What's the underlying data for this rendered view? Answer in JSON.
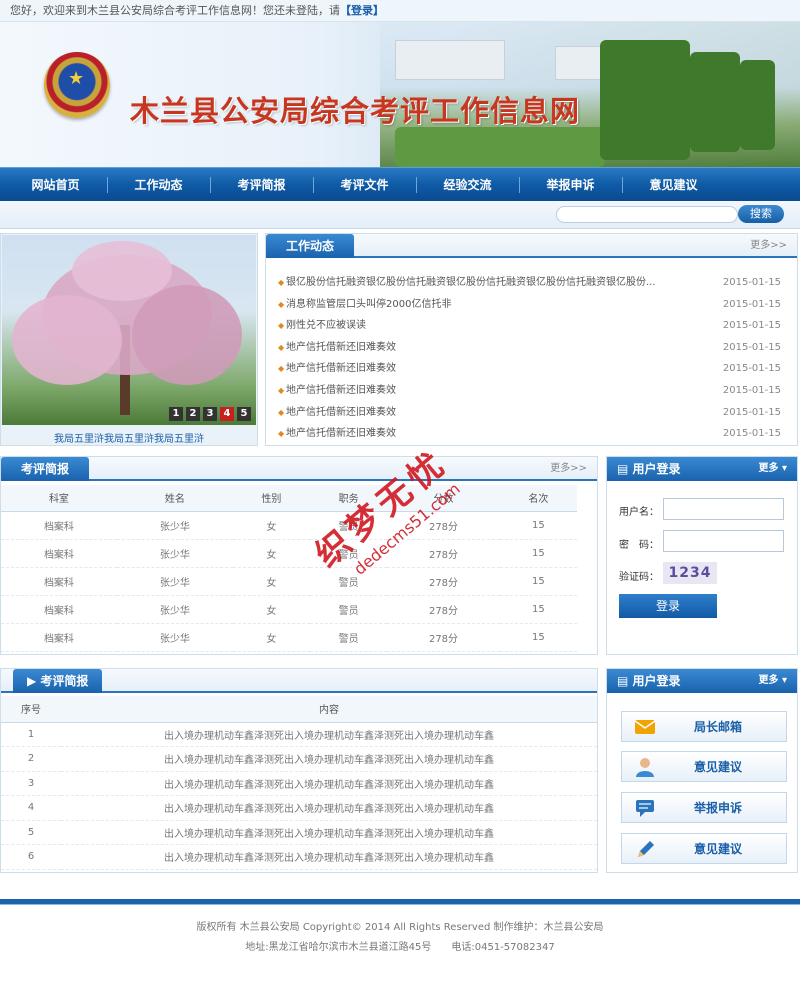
{
  "topbar": {
    "greeting": "您好，欢迎来到木兰县公安局综合考评工作信息网！您还未登陆，请",
    "login_link": "【登录】"
  },
  "header": {
    "site_title": "木兰县公安局综合考评工作信息网"
  },
  "nav": {
    "items": [
      "网站首页",
      "工作动态",
      "考评简报",
      "考评文件",
      "经验交流",
      "举报申诉",
      "意见建议"
    ]
  },
  "search": {
    "placeholder": "",
    "button": "搜索"
  },
  "slideshow": {
    "pages": [
      "1",
      "2",
      "3",
      "4",
      "5"
    ],
    "active_page": "4",
    "caption": "我局五里浒我局五里浒我局五里浒"
  },
  "work_news": {
    "title": "工作动态",
    "more": "更多>>",
    "items": [
      {
        "title": "银亿股份信托融资银亿股份信托融资银亿股份信托融资银亿股份信托融资银亿股份...",
        "date": "2015-01-15"
      },
      {
        "title": "消息称监管层口头叫停2000亿信托非",
        "date": "2015-01-15"
      },
      {
        "title": "刚性兑不应被误读",
        "date": "2015-01-15"
      },
      {
        "title": "地产信托借新还旧难奏效",
        "date": "2015-01-15"
      },
      {
        "title": "地产信托借新还旧难奏效",
        "date": "2015-01-15"
      },
      {
        "title": "地产信托借新还旧难奏效",
        "date": "2015-01-15"
      },
      {
        "title": "地产信托借新还旧难奏效",
        "date": "2015-01-15"
      },
      {
        "title": "地产信托借新还旧难奏效",
        "date": "2015-01-15"
      }
    ]
  },
  "ranking": {
    "title": "考评简报",
    "more": "更多>>",
    "columns": [
      "科室",
      "姓名",
      "性别",
      "职务",
      "分数",
      "名次"
    ],
    "rows": [
      [
        "档案科",
        "张少华",
        "女",
        "警员",
        "278分",
        "15"
      ],
      [
        "档案科",
        "张少华",
        "女",
        "警员",
        "278分",
        "15"
      ],
      [
        "档案科",
        "张少华",
        "女",
        "警员",
        "278分",
        "15"
      ],
      [
        "档案科",
        "张少华",
        "女",
        "警员",
        "278分",
        "15"
      ],
      [
        "档案科",
        "张少华",
        "女",
        "警员",
        "278分",
        "15"
      ]
    ]
  },
  "login": {
    "title": "用户登录",
    "more": "更多",
    "username_label": "用户名：",
    "password_label": "密　码：",
    "captcha_label": "验证码：",
    "captcha_value": "1234",
    "submit": "登录"
  },
  "briefing": {
    "title": "考评简报",
    "columns": [
      "序号",
      "内容"
    ],
    "rows": [
      [
        "1",
        "出入境办理机动车鑫泽测死出入境办理机动车鑫泽测死出入境办理机动车鑫"
      ],
      [
        "2",
        "出入境办理机动车鑫泽测死出入境办理机动车鑫泽测死出入境办理机动车鑫"
      ],
      [
        "3",
        "出入境办理机动车鑫泽测死出入境办理机动车鑫泽测死出入境办理机动车鑫"
      ],
      [
        "4",
        "出入境办理机动车鑫泽测死出入境办理机动车鑫泽测死出入境办理机动车鑫"
      ],
      [
        "5",
        "出入境办理机动车鑫泽测死出入境办理机动车鑫泽测死出入境办理机动车鑫"
      ],
      [
        "6",
        "出入境办理机动车鑫泽测死出入境办理机动车鑫泽测死出入境办理机动车鑫"
      ]
    ]
  },
  "quick_links": {
    "title": "用户登录",
    "more": "更多",
    "items": [
      {
        "label": "局长邮箱",
        "icon": "mail-icon",
        "color": "#f0a400"
      },
      {
        "label": "意见建议",
        "icon": "user-icon",
        "color": "#3a8ad3"
      },
      {
        "label": "举报申诉",
        "icon": "chat-icon",
        "color": "#2a74bd"
      },
      {
        "label": "意见建议",
        "icon": "pencil-icon",
        "color": "#2a74bd"
      }
    ]
  },
  "footer": {
    "line1": "版权所有 木兰县公安局 Copyright© 2014 All Rights Reserved 制作维护：木兰县公安局",
    "line2": "地址:黑龙江省哈尔滨市木兰县道江路45号　　电话:0451-57082347"
  },
  "watermark": {
    "text": "织梦无忧",
    "url": "dedecms51.com"
  },
  "colors": {
    "primary": "#1a62ad",
    "title_red": "#c7361f",
    "bullet": "#e08a1e"
  }
}
